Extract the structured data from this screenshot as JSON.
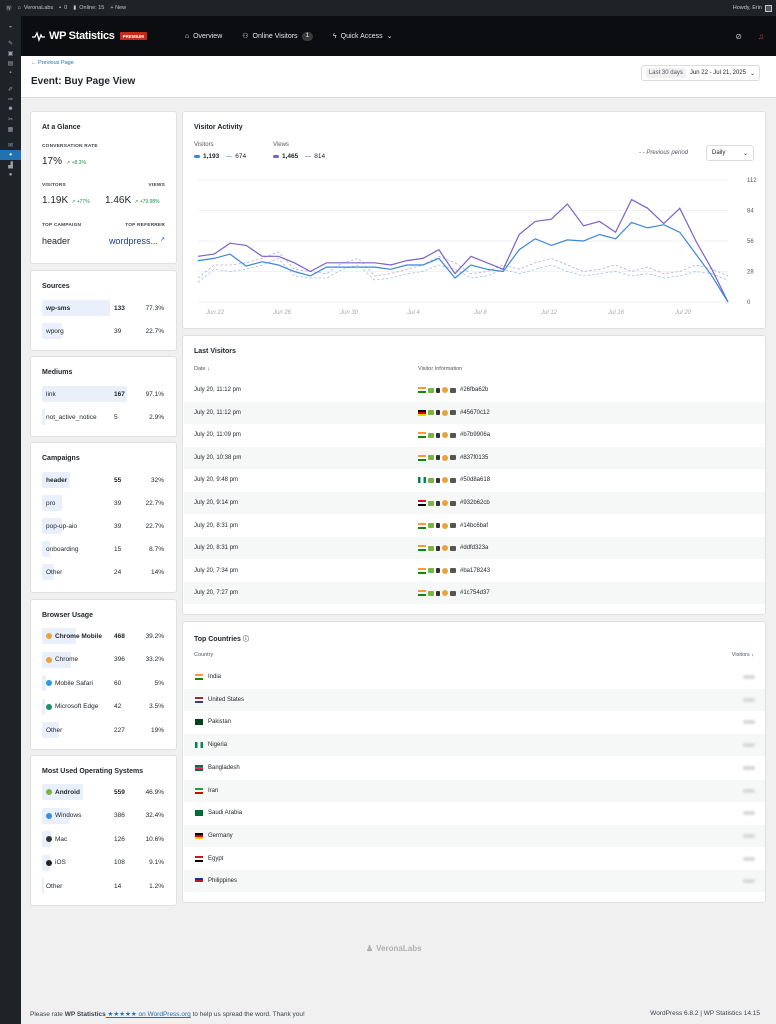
{
  "adminbar": {
    "site": "VeronaLabs",
    "comments": "0",
    "online": "Online: 15",
    "new": "+ New",
    "howdy": "Howdy, Erin"
  },
  "nav": {
    "brand": "WP Statistics",
    "premium": "PREMIUM",
    "overview": "Overview",
    "online_visitors": "Online Visitors",
    "online_count": "1",
    "quick_access": "Quick Access"
  },
  "header": {
    "prev": "← Previous Page",
    "title": "Event: Buy Page View",
    "range_label": "Last 30 days",
    "range": "Jun 22 - Jul 21, 2025"
  },
  "glance": {
    "title": "At a Glance",
    "conv_label": "CONVERSATION RATE",
    "conv_value": "17%",
    "conv_change": "↗ +8.3%",
    "visitors_label": "VISITORS",
    "views_label": "VIEWS",
    "visitors_value": "1.19K",
    "visitors_change": "↗ +77%",
    "views_value": "1.46K",
    "views_change": "↗ +79.98%",
    "campaign_label": "TOP CAMPAIGN",
    "referrer_label": "TOP REFERRER",
    "campaign_value": "header",
    "referrer_value": "wordpress...",
    "referrer_icon": "external-link-icon"
  },
  "sources": {
    "title": "Sources",
    "rows": [
      {
        "label": "wp-sms",
        "num": "133",
        "pct": "77.3%",
        "share": 77.3
      },
      {
        "label": "wporg",
        "num": "39",
        "pct": "22.7%",
        "share": 22.7
      }
    ]
  },
  "mediums": {
    "title": "Mediums",
    "rows": [
      {
        "label": "link",
        "num": "167",
        "pct": "97.1%",
        "share": 97.1
      },
      {
        "label": "not_active_notice",
        "num": "5",
        "pct": "2.9%",
        "share": 2.9
      }
    ]
  },
  "campaigns": {
    "title": "Campaigns",
    "rows": [
      {
        "label": "header",
        "num": "55",
        "pct": "32%",
        "share": 32
      },
      {
        "label": "pro",
        "num": "39",
        "pct": "22.7%",
        "share": 22.7
      },
      {
        "label": "pop-up-aio",
        "num": "39",
        "pct": "22.7%",
        "share": 22.7
      },
      {
        "label": "onboarding",
        "num": "15",
        "pct": "8.7%",
        "share": 8.7
      },
      {
        "label": "Other",
        "num": "24",
        "pct": "14%",
        "share": 14
      }
    ]
  },
  "browsers": {
    "title": "Browser Usage",
    "rows": [
      {
        "label": "Chrome Mobile",
        "num": "468",
        "pct": "39.2%",
        "share": 39.2,
        "icon": "chrome-icon",
        "color": "#e8a33d"
      },
      {
        "label": "Chrome",
        "num": "396",
        "pct": "33.2%",
        "share": 33.2,
        "icon": "chrome-icon",
        "color": "#e8a33d"
      },
      {
        "label": "Mobile Safari",
        "num": "60",
        "pct": "5%",
        "share": 5,
        "icon": "safari-icon",
        "color": "#2d9cdb"
      },
      {
        "label": "Microsoft Edge",
        "num": "42",
        "pct": "3.5%",
        "share": 3.5,
        "icon": "edge-icon",
        "color": "#1e8e6e"
      },
      {
        "label": "Other",
        "num": "227",
        "pct": "19%",
        "share": 19,
        "icon": "",
        "color": ""
      }
    ]
  },
  "os": {
    "title": "Most Used Operating Systems",
    "rows": [
      {
        "label": "Android",
        "num": "559",
        "pct": "46.9%",
        "share": 46.9,
        "icon": "android-icon",
        "color": "#7cb342"
      },
      {
        "label": "Windows",
        "num": "386",
        "pct": "32.4%",
        "share": 32.4,
        "icon": "windows-icon",
        "color": "#3a8ee6"
      },
      {
        "label": "Mac",
        "num": "126",
        "pct": "10.6%",
        "share": 10.6,
        "icon": "apple-icon",
        "color": "#333333"
      },
      {
        "label": "iOS",
        "num": "108",
        "pct": "9.1%",
        "share": 9.1,
        "icon": "ios-icon",
        "color": "#222222"
      },
      {
        "label": "Other",
        "num": "14",
        "pct": "1.2%",
        "share": 1.2,
        "icon": "",
        "color": ""
      }
    ]
  },
  "activity": {
    "title": "Visitor Activity",
    "visitors_label": "Visitors",
    "views_label": "Views",
    "visitors_value": "1,193",
    "visitors_prev": "674",
    "views_value": "1,465",
    "views_prev": "814",
    "prev_label": "- - Previous period",
    "period": "Daily"
  },
  "chart_data": {
    "type": "line",
    "x": [
      "Jun 22",
      "Jun 26",
      "Jun 30",
      "Jul 4",
      "Jul 8",
      "Jul 12",
      "Jul 16",
      "Jul 20"
    ],
    "ylim": [
      0,
      112
    ],
    "yticks": [
      0,
      28,
      56,
      84,
      112
    ],
    "series": [
      {
        "name": "Visitors",
        "color": "#3a87d8",
        "dashed": false,
        "values": [
          38,
          40,
          44,
          33,
          37,
          34,
          28,
          24,
          32,
          32,
          32,
          32,
          30,
          34,
          34,
          40,
          22,
          34,
          30,
          28,
          48,
          58,
          52,
          57,
          56,
          62,
          58,
          73,
          68,
          71,
          64,
          44,
          24,
          0
        ]
      },
      {
        "name": "Views",
        "color": "#7b61c9",
        "dashed": false,
        "values": [
          42,
          44,
          54,
          52,
          42,
          42,
          36,
          28,
          36,
          36,
          36,
          36,
          34,
          38,
          40,
          48,
          26,
          42,
          36,
          30,
          62,
          74,
          76,
          90,
          70,
          74,
          64,
          94,
          86,
          72,
          86,
          56,
          30,
          0
        ]
      },
      {
        "name": "Visitors (previous)",
        "color": "#9ec1ea",
        "dashed": true,
        "values": [
          18,
          30,
          28,
          30,
          34,
          40,
          24,
          22,
          22,
          30,
          34,
          20,
          22,
          26,
          28,
          34,
          30,
          22,
          24,
          30,
          26,
          30,
          34,
          28,
          24,
          26,
          28,
          24,
          26,
          22,
          24,
          28,
          26,
          20
        ]
      },
      {
        "name": "Views (previous)",
        "color": "#b6a8e3",
        "dashed": true,
        "values": [
          22,
          34,
          34,
          36,
          40,
          46,
          30,
          28,
          26,
          36,
          40,
          24,
          26,
          30,
          34,
          42,
          36,
          26,
          28,
          34,
          30,
          36,
          40,
          34,
          28,
          30,
          34,
          28,
          32,
          26,
          28,
          34,
          30,
          24
        ]
      }
    ]
  },
  "last_visitors": {
    "title": "Last Visitors",
    "date_col": "Date ↓",
    "info_col": "Visitor Information",
    "rows": [
      {
        "date": "July 20, 11:12 pm",
        "hash": "#26fba62b",
        "flag": "india"
      },
      {
        "date": "July 20, 11:12 pm",
        "hash": "#45670c12",
        "flag": "germany"
      },
      {
        "date": "July 20, 11:09 pm",
        "hash": "#b7b9906a",
        "flag": "india"
      },
      {
        "date": "July 20, 10:38 pm",
        "hash": "#837f0135",
        "flag": "india"
      },
      {
        "date": "July 20, 9:48 pm",
        "hash": "#50d8a618",
        "flag": "nigeria"
      },
      {
        "date": "July 20, 9:14 pm",
        "hash": "#932b62cb",
        "flag": "egypt"
      },
      {
        "date": "July 20, 8:31 pm",
        "hash": "#14bc6baf",
        "flag": "india"
      },
      {
        "date": "July 20, 8:31 pm",
        "hash": "#ddfd323a",
        "flag": "india"
      },
      {
        "date": "July 20, 7:34 pm",
        "hash": "#ba178243",
        "flag": "india"
      },
      {
        "date": "July 20, 7:27 pm",
        "hash": "#1c754d37",
        "flag": "india"
      }
    ]
  },
  "countries": {
    "title": "Top Countries",
    "country_col": "Country",
    "visitors_col": "Visitors ↓",
    "rows": [
      {
        "name": "India",
        "flag": "india"
      },
      {
        "name": "United States",
        "flag": "us"
      },
      {
        "name": "Pakistan",
        "flag": "pakistan"
      },
      {
        "name": "Nigeria",
        "flag": "nigeria"
      },
      {
        "name": "Bangladesh",
        "flag": "bangladesh"
      },
      {
        "name": "Iran",
        "flag": "iran"
      },
      {
        "name": "Saudi Arabia",
        "flag": "saudi"
      },
      {
        "name": "Germany",
        "flag": "germany"
      },
      {
        "name": "Egypt",
        "flag": "egypt"
      },
      {
        "name": "Philippines",
        "flag": "philippines"
      }
    ]
  },
  "brand_footer": "VeronaLabs",
  "footer": {
    "left_a": "Please rate ",
    "left_b": "WP Statistics",
    "left_c": " ★★★★★ on WordPress.org",
    "left_d": " to help us spread the word. Thank you!",
    "right": "WordPress 6.8.2 | WP Statistics 14.15"
  }
}
